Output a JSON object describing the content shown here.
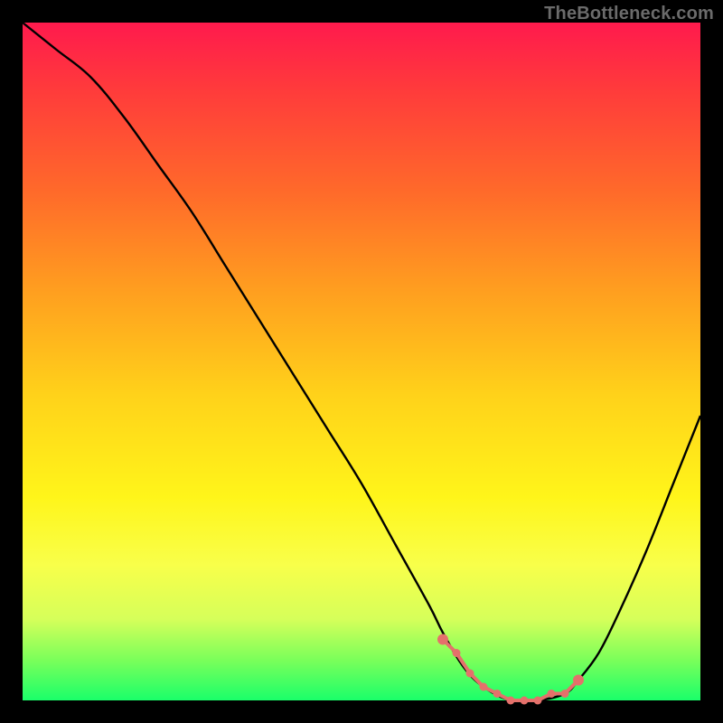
{
  "watermark": "TheBottleneck.com",
  "colors": {
    "background": "#000000",
    "curve": "#000000",
    "marker": "#e4716b",
    "gradient_top": "#ff1a4d",
    "gradient_bottom": "#1aff6a"
  },
  "chart_data": {
    "type": "line",
    "title": "",
    "xlabel": "",
    "ylabel": "",
    "xlim": [
      0,
      100
    ],
    "ylim": [
      0,
      100
    ],
    "series": [
      {
        "name": "bottleneck-curve",
        "x": [
          0,
          5,
          10,
          15,
          20,
          25,
          30,
          35,
          40,
          45,
          50,
          55,
          60,
          62,
          65,
          68,
          72,
          76,
          80,
          82,
          85,
          88,
          92,
          96,
          100
        ],
        "values": [
          100,
          96,
          92,
          86,
          79,
          72,
          64,
          56,
          48,
          40,
          32,
          23,
          14,
          10,
          5,
          2,
          0,
          0,
          1,
          3,
          7,
          13,
          22,
          32,
          42
        ]
      }
    ],
    "markers": {
      "name": "optimal-zone",
      "x": [
        62,
        64,
        66,
        68,
        70,
        72,
        74,
        76,
        78,
        80,
        82
      ],
      "values": [
        9,
        7,
        4,
        2,
        1,
        0,
        0,
        0,
        1,
        1,
        3
      ]
    }
  }
}
